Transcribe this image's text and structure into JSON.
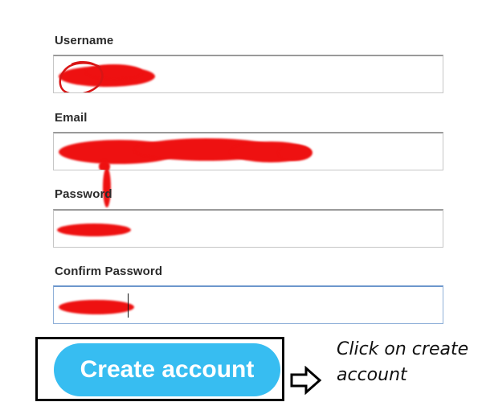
{
  "form": {
    "username": {
      "label": "Username",
      "value": ""
    },
    "email": {
      "label": "Email",
      "value": ""
    },
    "password": {
      "label": "Password",
      "value": ""
    },
    "confirm_password": {
      "label": "Confirm Password",
      "value": ""
    }
  },
  "actions": {
    "create_account_label": "Create account"
  },
  "annotation": {
    "line1": "Click on create",
    "line2": "account",
    "arrow_icon": "hollow-right-arrow"
  },
  "colors": {
    "button": "#37bdf1",
    "redaction": "#ee1111",
    "focus_border": "#6d97cc"
  }
}
